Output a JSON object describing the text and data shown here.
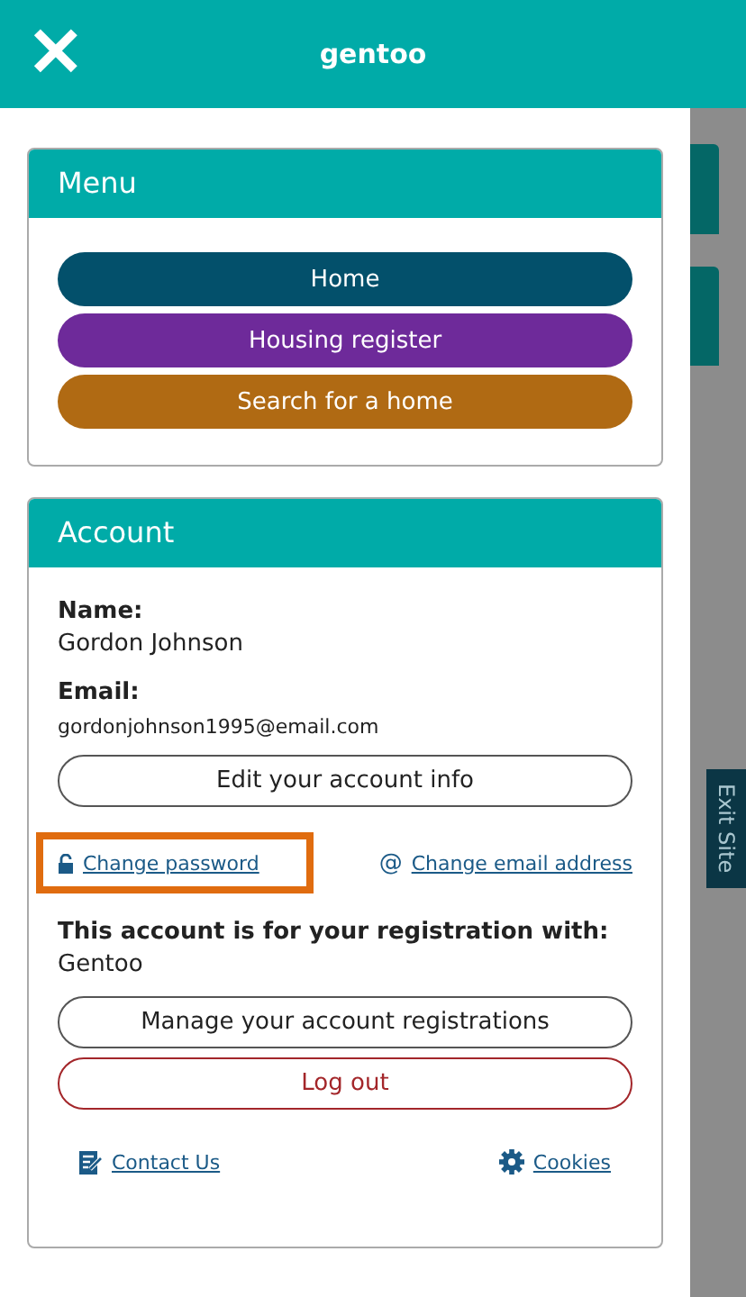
{
  "header": {
    "close_icon": "✕",
    "logo": "gentoo"
  },
  "menu": {
    "title": "Menu",
    "items": [
      {
        "label": "Home",
        "color": "#03506b"
      },
      {
        "label": "Housing register",
        "color": "#6e2a9a"
      },
      {
        "label": "Search for a home",
        "color": "#b06a13"
      }
    ]
  },
  "account": {
    "title": "Account",
    "name_label": "Name:",
    "name": "Gordon Johnson",
    "email_label": "Email:",
    "email": "gordonjohnson1995@email.com",
    "edit_button": "Edit your account info",
    "links": [
      {
        "kind": "lock",
        "label": "Change password",
        "highlighted": true
      },
      {
        "kind": "at",
        "icon": "@",
        "label": "Change email address",
        "highlighted": false
      }
    ],
    "registration_heading": "This account is for your registration with:",
    "registration": "Gentoo",
    "manage_button": "Manage your account registrations",
    "logout_button": "Log out",
    "footer_links": [
      {
        "kind": "contact",
        "label": "Contact Us"
      },
      {
        "kind": "cookies",
        "label": "Cookies"
      }
    ]
  },
  "exit_site": "Exit Site"
}
